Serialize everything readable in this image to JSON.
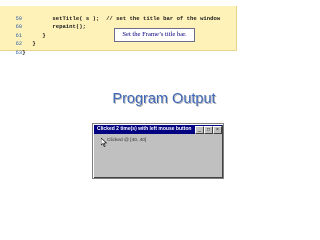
{
  "code_listing": {
    "lines": [
      {
        "number": "59",
        "code": "         setTitle( s );  // set the title bar of the window"
      },
      {
        "number": "60",
        "code": "         repaint();"
      },
      {
        "number": "61",
        "code": "      }"
      },
      {
        "number": "62",
        "code": "   }"
      },
      {
        "number": "63",
        "code": "}"
      }
    ],
    "callout": "Set the Frame’s title bar."
  },
  "output": {
    "heading": "Program Output",
    "window": {
      "title": "Clicked 2 time(s) with left mouse button",
      "buttons": {
        "minimize": "_",
        "maximize": "□",
        "close": "×"
      },
      "clicked_text": "Clicked @ [40, 40]"
    }
  },
  "colors": {
    "code_background": "#fff2b8",
    "line_number": "#2f5fa6",
    "heading": "#3e67b8",
    "titlebar": "#000080"
  }
}
